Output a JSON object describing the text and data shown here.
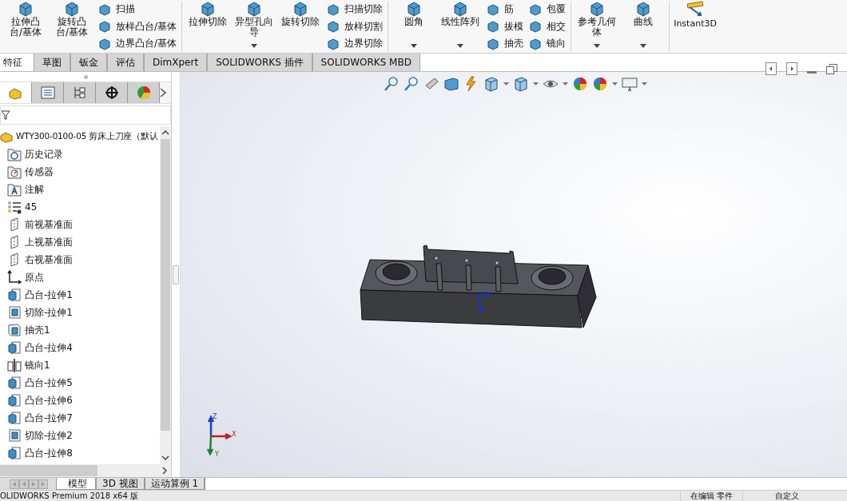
{
  "toolbar": {
    "groups": [
      {
        "big": [
          {
            "label": "拉伸凸台/基体",
            "dropdown": false
          },
          {
            "label": "旋转凸台/基体",
            "dropdown": false
          }
        ],
        "small": [
          [
            "扫描",
            "放样凸台/基体",
            "边界凸台/基体"
          ]
        ]
      },
      {
        "big": [
          {
            "label": "拉伸切除",
            "dropdown": false
          },
          {
            "label": "异型孔向导",
            "dropdown": true
          },
          {
            "label": "旋转切除",
            "dropdown": false
          }
        ],
        "small": [
          [
            "扫描切除",
            "放样切割",
            "边界切除"
          ]
        ]
      },
      {
        "big": [
          {
            "label": "圆角",
            "dropdown": true
          },
          {
            "label": "线性阵列",
            "dropdown": true
          }
        ],
        "small": [
          [
            "筋",
            "拔模",
            "抽壳"
          ],
          [
            "包覆",
            "相交",
            "镜向"
          ]
        ]
      },
      {
        "big": [
          {
            "label": "参考几何体",
            "dropdown": true
          },
          {
            "label": "曲线",
            "dropdown": true
          }
        ]
      },
      {
        "big": [
          {
            "label": "Instant3D",
            "dropdown": false
          }
        ]
      }
    ]
  },
  "tabs": [
    {
      "label": "特征",
      "selected": true
    },
    {
      "label": "草图",
      "selected": false
    },
    {
      "label": "钣金",
      "selected": false
    },
    {
      "label": "评估",
      "selected": false
    },
    {
      "label": "DimXpert",
      "selected": false
    },
    {
      "label": "SOLIDWORKS 插件",
      "selected": false
    },
    {
      "label": "SOLIDWORKS MBD",
      "selected": false
    }
  ],
  "panel_tabs": [
    {
      "kind": "feature",
      "selected": true
    },
    {
      "kind": "property",
      "selected": false
    },
    {
      "kind": "config",
      "selected": false
    },
    {
      "kind": "dimxpert",
      "selected": false
    },
    {
      "kind": "display",
      "selected": false
    }
  ],
  "tree": {
    "label": "WTY300-0100-05 剪床上刀座（默认",
    "children": [
      {
        "label": "历史记录",
        "kind": "history"
      },
      {
        "label": "传感器",
        "kind": "sensor"
      },
      {
        "label": "注解",
        "kind": "annotation"
      },
      {
        "label": "45",
        "kind": "material"
      },
      {
        "label": "前视基准面",
        "kind": "plane"
      },
      {
        "label": "上视基准面",
        "kind": "plane"
      },
      {
        "label": "右视基准面",
        "kind": "plane"
      },
      {
        "label": "原点",
        "kind": "origin"
      },
      {
        "label": "凸台-拉伸1",
        "kind": "boss"
      },
      {
        "label": "切除-拉伸1",
        "kind": "cut"
      },
      {
        "label": "抽壳1",
        "kind": "shell"
      },
      {
        "label": "凸台-拉伸4",
        "kind": "boss"
      },
      {
        "label": "镜向1",
        "kind": "mirror"
      },
      {
        "label": "凸台-拉伸5",
        "kind": "boss"
      },
      {
        "label": "凸台-拉伸6",
        "kind": "boss"
      },
      {
        "label": "凸台-拉伸7",
        "kind": "boss"
      },
      {
        "label": "切除-拉伸2",
        "kind": "cut"
      },
      {
        "label": "凸台-拉伸8",
        "kind": "boss"
      }
    ]
  },
  "triad": {
    "z": "Z",
    "x": "X",
    "y": "Y"
  },
  "bottom_tabs": [
    {
      "label": "模型",
      "selected": true
    },
    {
      "label": "3D 视图",
      "selected": false
    },
    {
      "label": "运动算例 1",
      "selected": false
    }
  ],
  "status_bar": {
    "product": "OLIDWORKS Premium 2018 x64 版",
    "mode": "在编辑 零件",
    "units": "自定义"
  }
}
